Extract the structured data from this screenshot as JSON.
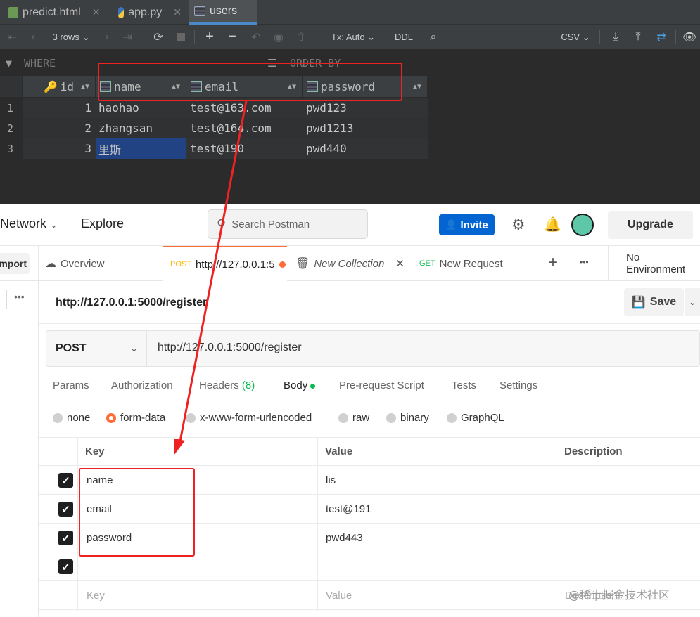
{
  "ide": {
    "tabs": [
      {
        "label": "predict.html",
        "close": "✕"
      },
      {
        "label": "app.py",
        "close": "✕"
      },
      {
        "label": "users"
      }
    ],
    "toolbar": {
      "rows_label": "3 rows",
      "tx_label": "Tx: Auto",
      "ddl_label": "DDL",
      "csv_label": "CSV"
    },
    "filter": {
      "where": "WHERE",
      "order_by": "ORDER BY"
    },
    "grid": {
      "columns": [
        "id",
        "name",
        "email",
        "password"
      ],
      "rows": [
        {
          "num": "1",
          "id": "1",
          "name": "haohao",
          "email": "test@163.com",
          "password": "pwd123"
        },
        {
          "num": "2",
          "id": "2",
          "name": "zhangsan",
          "email": "test@164.com",
          "password": "pwd1213"
        },
        {
          "num": "3",
          "id": "3",
          "name": "里斯",
          "email": "test@190",
          "password": "pwd440"
        }
      ]
    }
  },
  "postman": {
    "nav": {
      "network": "Network",
      "explore": "Explore"
    },
    "search_placeholder": "Search Postman",
    "invite_label": "Invite",
    "upgrade_label": "Upgrade",
    "import_label": "mport",
    "tabs": {
      "overview": "Overview",
      "post_method": "POST",
      "post_url": "http://127.0.0.1:5",
      "new_collection": "New Collection",
      "get_method": "GET",
      "new_request": "New Request",
      "environment": "No Environment"
    },
    "request": {
      "title": "http://127.0.0.1:5000/register",
      "save_label": "Save",
      "method": "POST",
      "url": "http://127.0.0.1:5000/register"
    },
    "option_tabs": {
      "params": "Params",
      "authorization": "Authorization",
      "headers": "Headers",
      "headers_count": "(8)",
      "body": "Body",
      "prerequest": "Pre-request Script",
      "tests": "Tests",
      "settings": "Settings"
    },
    "body_types": [
      "none",
      "form-data",
      "x-www-form-urlencoded",
      "raw",
      "binary",
      "GraphQL"
    ],
    "table": {
      "headers": {
        "key": "Key",
        "value": "Value",
        "description": "Description"
      },
      "rows": [
        {
          "key": "name",
          "value": "lis"
        },
        {
          "key": "email",
          "value": "test@191"
        },
        {
          "key": "password",
          "value": "pwd443"
        }
      ],
      "placeholder": {
        "key": "Key",
        "value": "Value",
        "description": "Description"
      }
    },
    "watermark": "@稀土掘金技术社区"
  },
  "colors": {
    "postman_orange": "#ff6c37",
    "invite_blue": "#0265d2",
    "annotation_red": "#ee2222",
    "ide_bg": "#2b2b2b"
  }
}
